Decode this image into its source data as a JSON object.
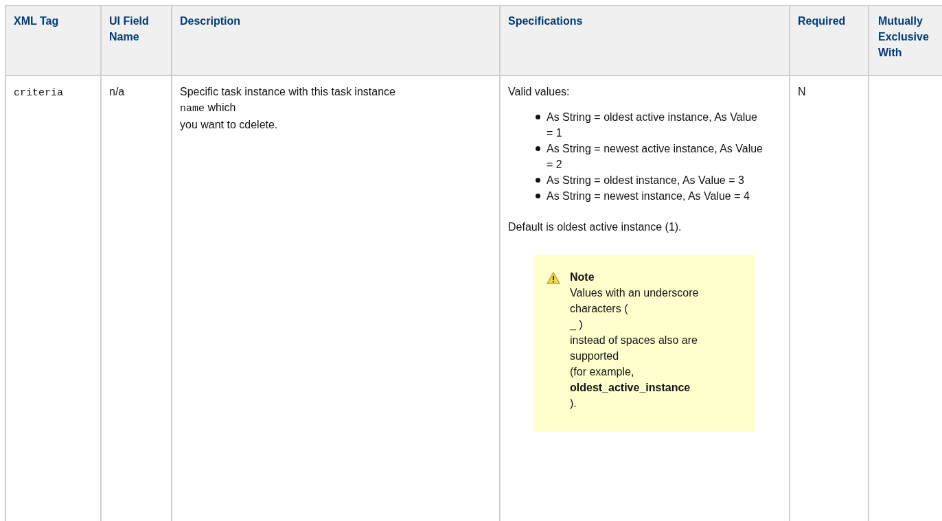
{
  "table": {
    "columns": [
      "XML Tag",
      "UI Field Name",
      "Description",
      "Specifications",
      "Required",
      "Mutually Exclusive With"
    ],
    "rows": [
      {
        "xml_tag": "criteria",
        "ui_field_name": "n/a",
        "description": [
          {
            "kind": "text",
            "text": "Specific task instance with this task instance"
          },
          {
            "kind": "break"
          },
          {
            "kind": "code",
            "text": "name"
          },
          {
            "kind": "text",
            "text": " which"
          },
          {
            "kind": "break"
          },
          {
            "kind": "text",
            "text": "you want to cdelete."
          }
        ],
        "specifications": {
          "intro": "Valid values:",
          "values": [
            "As String = oldest active instance, As Value = 1",
            "As String = newest active instance, As Value = 2",
            "As String = oldest instance, As Value = 3",
            "As String = newest instance, As Value = 4"
          ],
          "default": "Default is oldest active instance (1).",
          "note": {
            "title": "Note",
            "text": "Values with an underscore characters (\n_ )\ninstead of spaces also are supported\n(for example,\n**oldest_active_instance**\n)."
          }
        },
        "required": "N"
      }
    ]
  }
}
